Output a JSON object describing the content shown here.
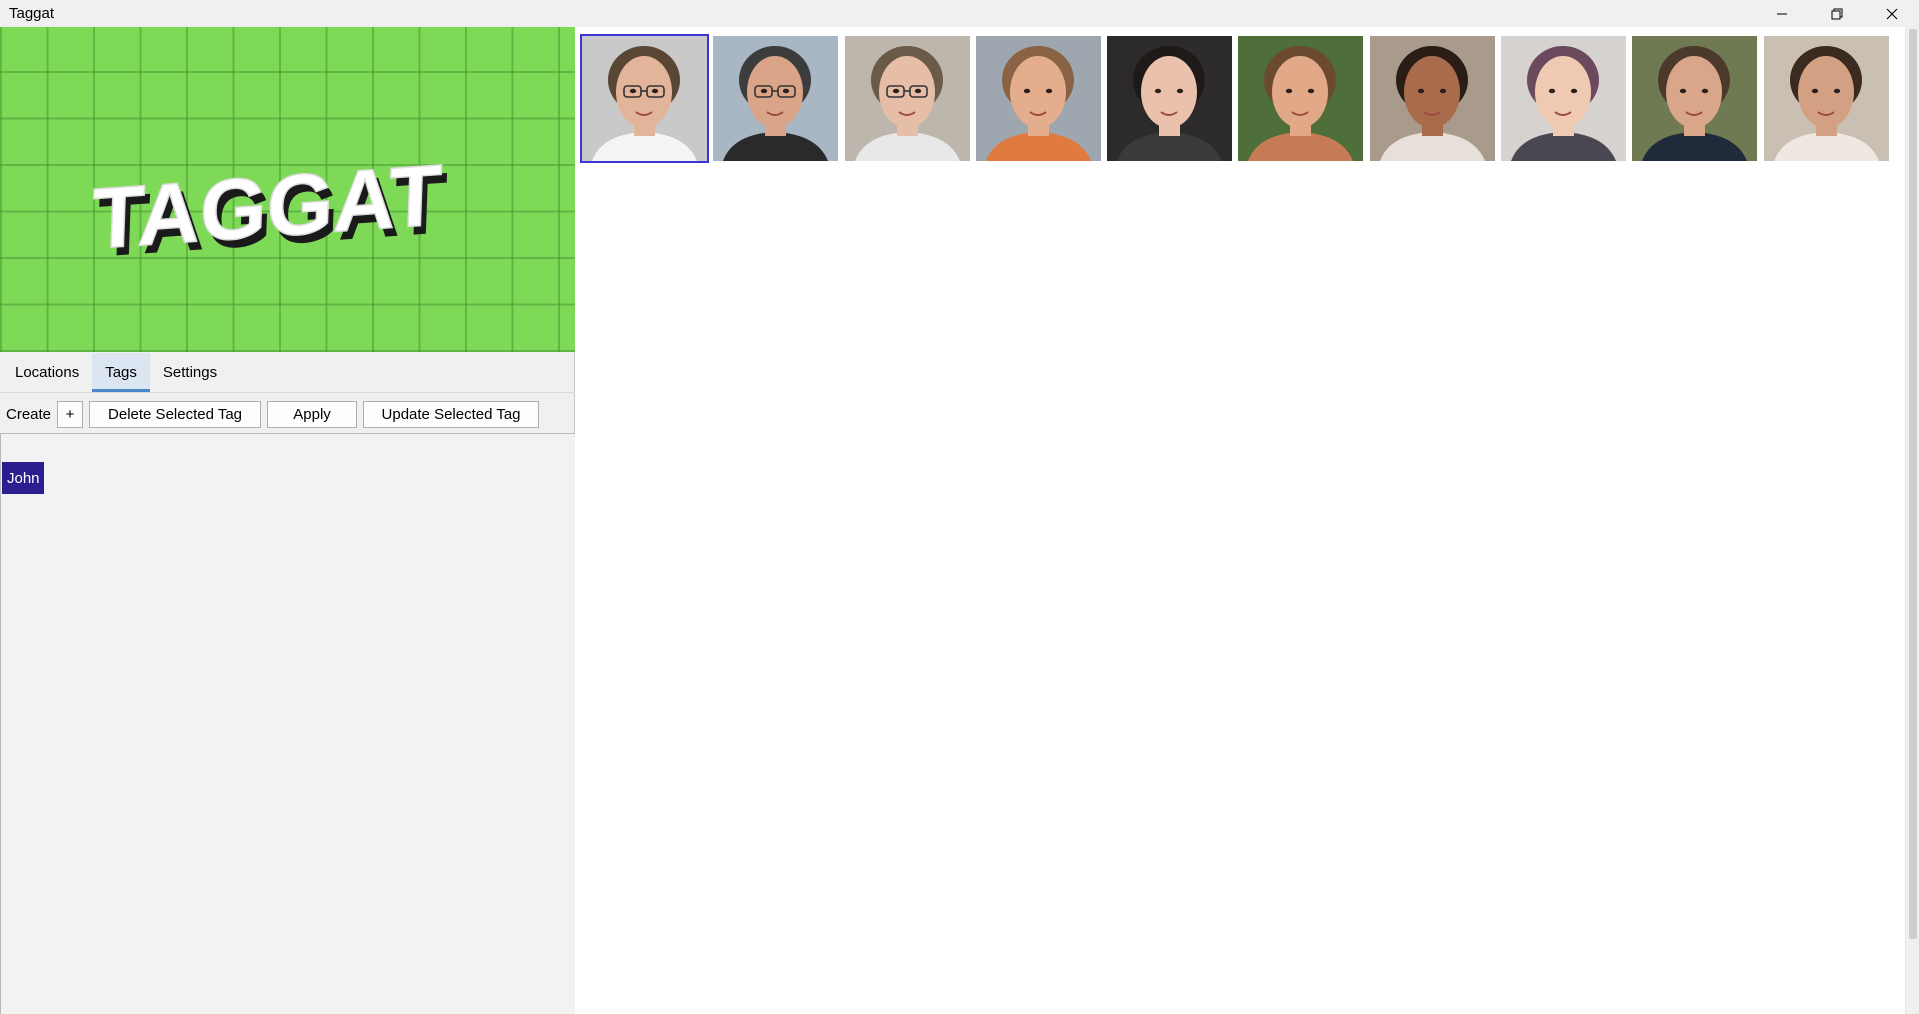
{
  "window": {
    "title": "Taggat",
    "controls": [
      "minimize-icon",
      "restore-icon",
      "close-icon"
    ]
  },
  "logo": {
    "text": "TAGGAT",
    "background": "#7ed957"
  },
  "tabs": [
    {
      "label": "Locations",
      "active": false
    },
    {
      "label": "Tags",
      "active": true
    },
    {
      "label": "Settings",
      "active": false
    }
  ],
  "toolbar": {
    "create_label": "Create",
    "plus_label": "+",
    "delete_label": "Delete Selected Tag",
    "apply_label": "Apply",
    "update_label": "Update Selected Tag"
  },
  "tags": [
    {
      "name": "John",
      "color": "#2d1e8f",
      "selected": true
    }
  ],
  "gallery": {
    "selected_index": 0,
    "images": [
      {
        "name": "face-photo-1",
        "bg": "#c9c9c9",
        "skin": "#e2b59a",
        "hair": "#5a4634",
        "shirt": "#f4f4f4",
        "glasses": true
      },
      {
        "name": "face-photo-2",
        "bg": "#a9b6c3",
        "skin": "#d9a488",
        "hair": "#3c3c3c",
        "shirt": "#2a2a2a",
        "glasses": true
      },
      {
        "name": "face-photo-3",
        "bg": "#bdb6ad",
        "skin": "#e6bda6",
        "hair": "#6a5a48",
        "shirt": "#e8e8e8",
        "glasses": true
      },
      {
        "name": "face-photo-4",
        "bg": "#9ea7b0",
        "skin": "#e3ad8e",
        "hair": "#8a6244",
        "shirt": "#e07a3e",
        "glasses": false
      },
      {
        "name": "face-photo-5",
        "bg": "#2c2a2a",
        "skin": "#eac1ac",
        "hair": "#1d1a18",
        "shirt": "#3a3a3a",
        "glasses": false
      },
      {
        "name": "face-photo-6",
        "bg": "#4f6f3a",
        "skin": "#e2a989",
        "hair": "#6b4a2f",
        "shirt": "#c77b55",
        "glasses": false
      },
      {
        "name": "face-photo-7",
        "bg": "#a89b8c",
        "skin": "#a86b4c",
        "hair": "#2a1d15",
        "shirt": "#e6e0d8",
        "glasses": false
      },
      {
        "name": "face-photo-8",
        "bg": "#d6d2cf",
        "skin": "#f0c9b3",
        "hair": "#6b4a5e",
        "shirt": "#4a4752",
        "glasses": false
      },
      {
        "name": "face-photo-9",
        "bg": "#6f7a52",
        "skin": "#d9a68a",
        "hair": "#4b3a2c",
        "shirt": "#1f2a3a",
        "glasses": false
      },
      {
        "name": "face-photo-10",
        "bg": "#c9bfb3",
        "skin": "#d4a083",
        "hair": "#3a2a1f",
        "shirt": "#efe8e0",
        "glasses": false
      }
    ]
  }
}
